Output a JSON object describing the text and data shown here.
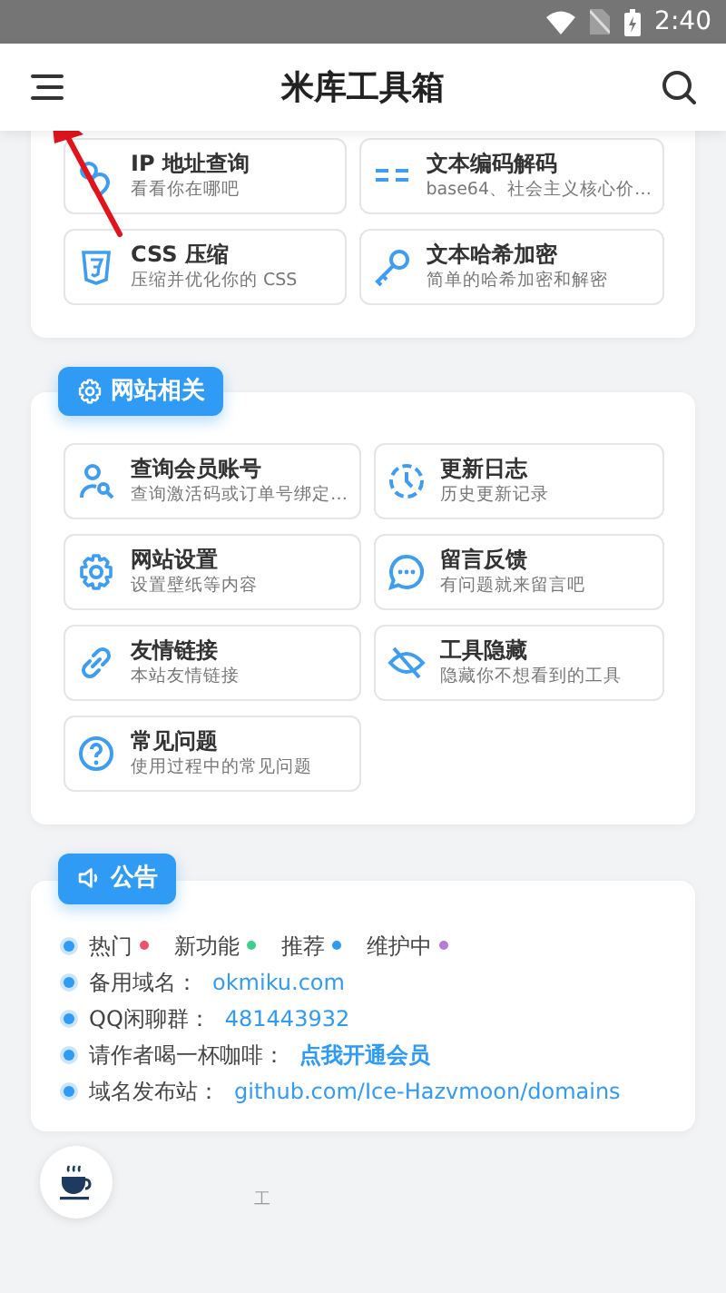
{
  "status_bar": {
    "time": "2:40"
  },
  "header": {
    "title": "米库工具箱"
  },
  "sections": [
    {
      "items": [
        {
          "title": "IP 地址查询",
          "desc": "看看你在哪吧"
        },
        {
          "title": "文本编码解码",
          "desc": "base64、社会主义核心价…"
        },
        {
          "title": "CSS 压缩",
          "desc": "压缩并优化你的 CSS"
        },
        {
          "title": "文本哈希加密",
          "desc": "简单的哈希加密和解密"
        }
      ]
    },
    {
      "title": "网站相关",
      "items": [
        {
          "title": "查询会员账号",
          "desc": "查询激活码或订单号绑定…"
        },
        {
          "title": "更新日志",
          "desc": "历史更新记录"
        },
        {
          "title": "网站设置",
          "desc": "设置壁纸等内容"
        },
        {
          "title": "留言反馈",
          "desc": "有问题就来留言吧"
        },
        {
          "title": "友情链接",
          "desc": "本站友情链接"
        },
        {
          "title": "工具隐藏",
          "desc": "隐藏你不想看到的工具"
        },
        {
          "title": "常见问题",
          "desc": "使用过程中的常见问题"
        }
      ]
    }
  ],
  "notice": {
    "title": "公告",
    "lines": [
      {
        "kind": "legend",
        "tags": [
          {
            "label": "热门",
            "color": "#f0506e"
          },
          {
            "label": "新功能",
            "color": "#3ecf8e"
          },
          {
            "label": "推荐",
            "color": "#2d9cf0"
          },
          {
            "label": "维护中",
            "color": "#b57bd6"
          }
        ]
      },
      {
        "kind": "link",
        "label": "备用域名：",
        "link": "okmiku.com",
        "strong": false
      },
      {
        "kind": "link",
        "label": "QQ闲聊群：",
        "link": "481443932",
        "strong": false
      },
      {
        "kind": "link",
        "label": "请作者喝一杯咖啡：",
        "link": "点我开通会员",
        "strong": true
      },
      {
        "kind": "link",
        "label": "域名发布站：",
        "link": "github.com/Ice-Hazvmoon/domains",
        "strong": false
      }
    ]
  },
  "footer": {
    "text": "工"
  }
}
